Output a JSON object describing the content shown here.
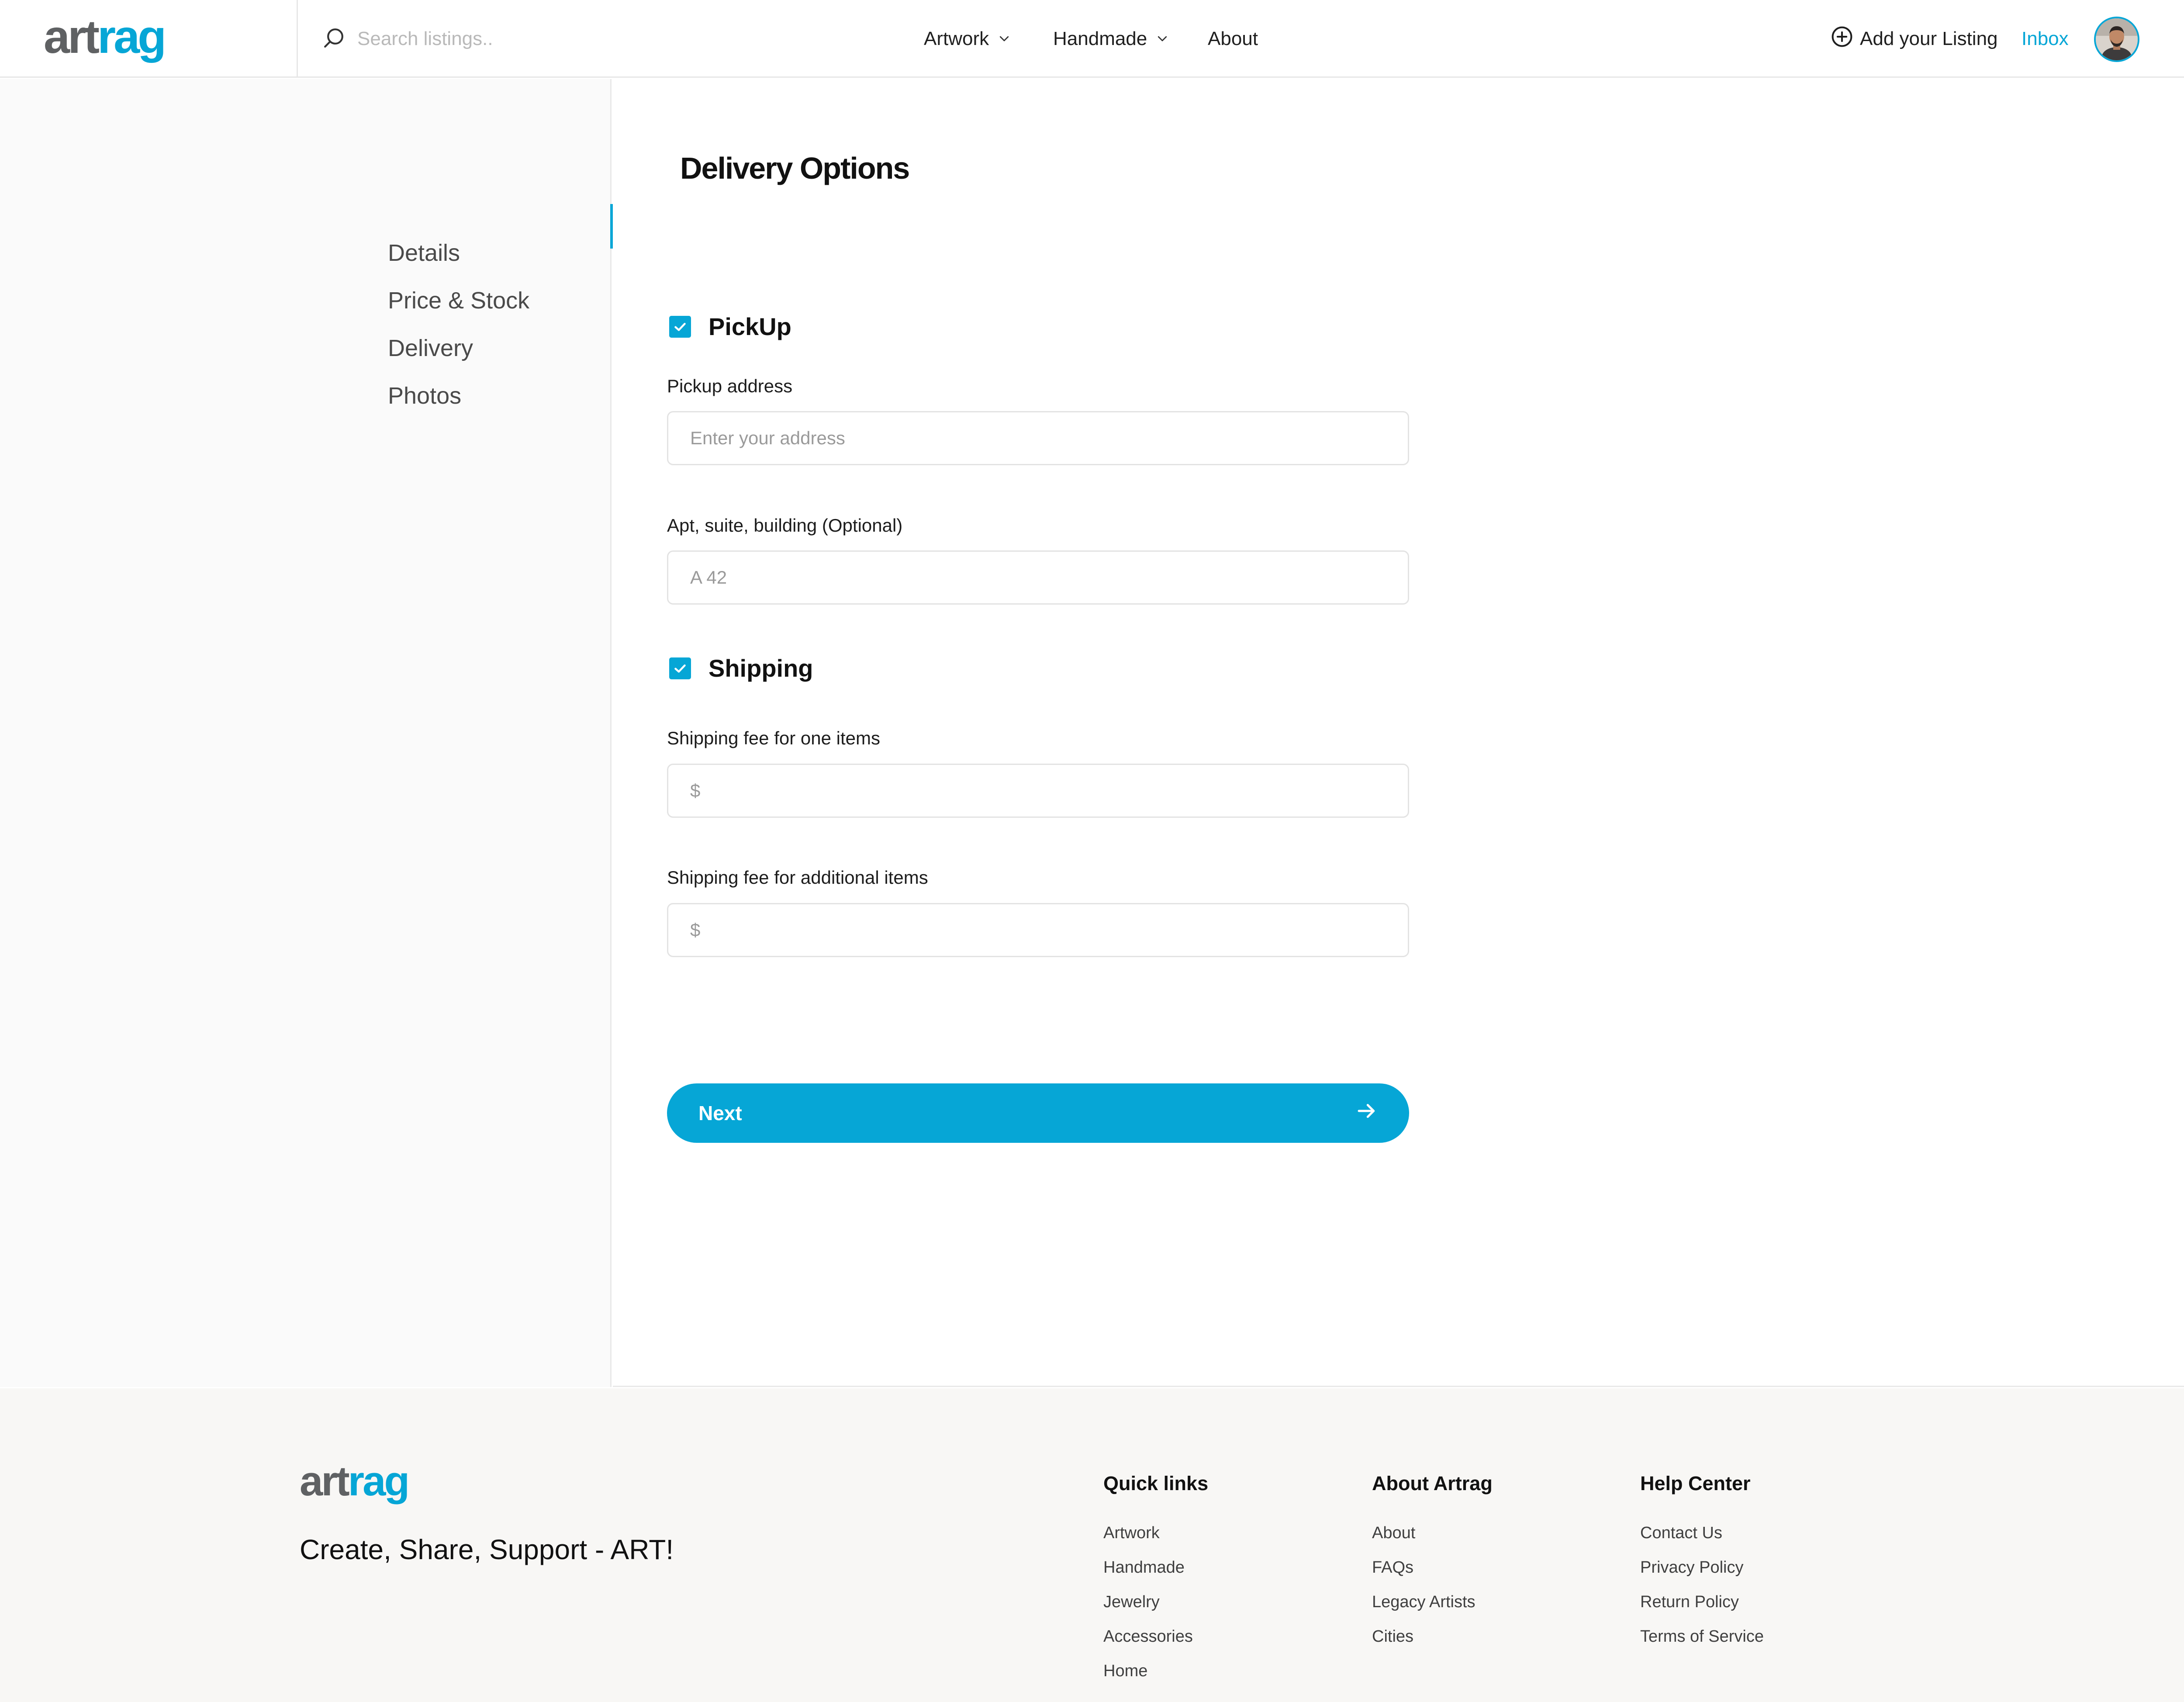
{
  "header": {
    "logo": {
      "part1": "art",
      "part2": "rag"
    },
    "search_placeholder": "Search listings..",
    "nav": [
      {
        "label": "Artwork",
        "has_dropdown": true
      },
      {
        "label": "Handmade",
        "has_dropdown": true
      },
      {
        "label": "About",
        "has_dropdown": false
      }
    ],
    "add_listing_label": "Add your Listing",
    "inbox_label": "Inbox",
    "accent_color": "#06a6d6"
  },
  "sidebar": {
    "items": [
      {
        "label": "Details"
      },
      {
        "label": "Price & Stock",
        "active": true
      },
      {
        "label": "Delivery"
      },
      {
        "label": "Photos"
      }
    ]
  },
  "main": {
    "title": "Delivery Options",
    "pickup": {
      "checkbox_label": "PickUp",
      "checked": true,
      "address_label": "Pickup address",
      "address_placeholder": "Enter your address",
      "apt_label": "Apt, suite, building (Optional)",
      "apt_placeholder": "A 42"
    },
    "shipping": {
      "checkbox_label": "Shipping",
      "checked": true,
      "fee_one_label": "Shipping fee for one items",
      "fee_one_placeholder": "$",
      "fee_additional_label": "Shipping fee for additional items",
      "fee_additional_placeholder": "$"
    },
    "next_label": "Next"
  },
  "footer": {
    "logo": {
      "part1": "art",
      "part2": "rag"
    },
    "tagline": "Create, Share, Support - ART!",
    "columns": [
      {
        "title": "Quick links",
        "links": [
          "Artwork",
          "Handmade",
          "Jewelry",
          "Accessories",
          "Home"
        ]
      },
      {
        "title": "About Artrag",
        "links": [
          "About",
          "FAQs",
          "Legacy Artists",
          "Cities"
        ]
      },
      {
        "title": "Help Center",
        "links": [
          "Contact Us",
          "Privacy Policy",
          "Return Policy",
          "Terms of Service"
        ]
      }
    ]
  }
}
